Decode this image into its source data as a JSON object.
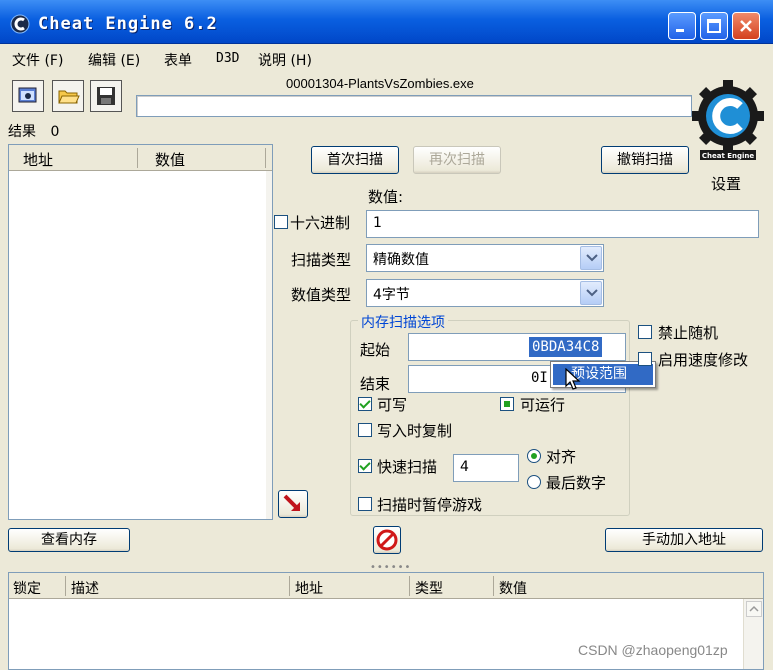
{
  "window": {
    "title": "Cheat Engine 6.2"
  },
  "menu": {
    "items": [
      "文件 (F)",
      "编辑 (E)",
      "表单",
      "D3D",
      "说明 (H)"
    ]
  },
  "toolbar": {
    "process_name": "00001304-PlantsVsZombies.exe",
    "icons": [
      "select-process-icon",
      "open-file-icon",
      "save-icon"
    ]
  },
  "results": {
    "label": "结果",
    "count": "0"
  },
  "address_list": {
    "columns": [
      "地址",
      "数值"
    ]
  },
  "scan": {
    "first_scan": "首次扫描",
    "next_scan": "再次扫描",
    "undo_scan": "撤销扫描",
    "settings": "设置",
    "value_label": "数值:",
    "hex_label": "十六进制",
    "value": "1",
    "scan_type_label": "扫描类型",
    "scan_type_value": "精确数值",
    "value_type_label": "数值类型",
    "value_type_value": "4字节"
  },
  "memory_options": {
    "title": "内存扫描选项",
    "start_label": "起始",
    "start_value": "0BDA34C8",
    "end_label": "结束",
    "end_value_visible": "0I",
    "popup_item": "预设范围",
    "writable": "可写",
    "executable": "可运行",
    "copy_on_write": "写入时复制",
    "fast_scan": "快速扫描",
    "fast_scan_value": "4",
    "align": "对齐",
    "last_digits": "最后数字",
    "pause_game": "扫描时暂停游戏"
  },
  "side_options": {
    "disable_random": "禁止随机",
    "speedhack": "启用速度修改"
  },
  "buttons": {
    "view_memory": "查看内存",
    "add_address": "手动加入地址"
  },
  "bottom_list": {
    "columns": [
      "锁定",
      "描述",
      "地址",
      "类型",
      "数值"
    ]
  },
  "watermark": "CSDN @zhaopeng01zp",
  "colors": {
    "titlebar": "#0a5fe0",
    "selection": "#316ac5",
    "group_title": "#0046d5",
    "window_bg": "#ece9d8"
  }
}
